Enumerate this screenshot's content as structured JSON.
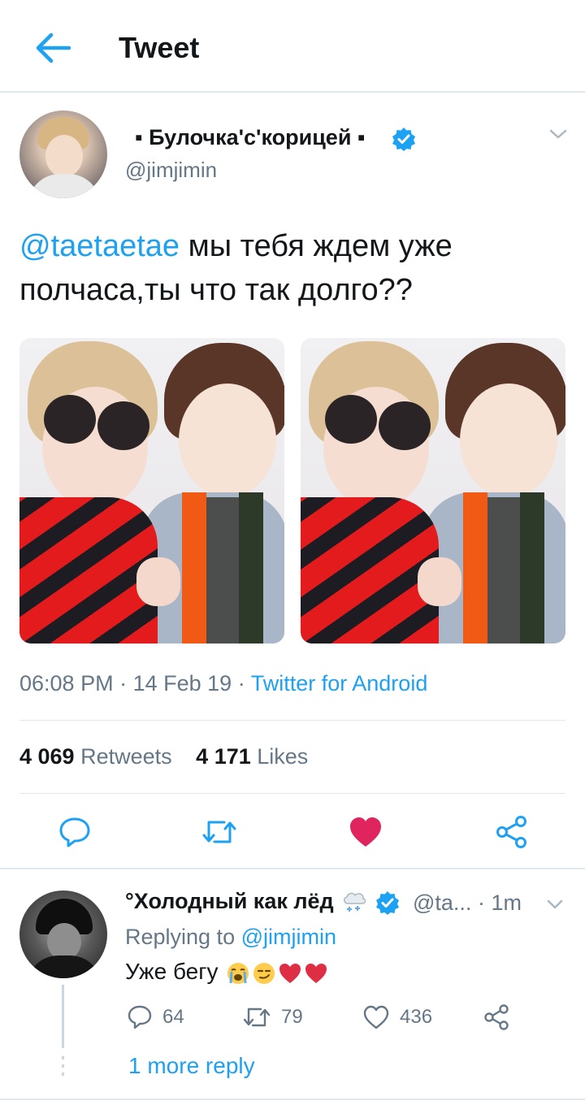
{
  "header": {
    "title": "Tweet",
    "back_icon": "arrow-left-icon"
  },
  "tweet": {
    "author_name": "▪ Булочка'с'корицей ▪",
    "handle": "@jimjimin",
    "verified": true,
    "text_mention": "@taetaetae",
    "text_body": " мы тебя ждем уже полчаса,ты что так долго??",
    "time": "06:08 PM",
    "date": "14 Feb 19",
    "separator": "·",
    "source": "Twitter for Android",
    "retweets_count": "4 069",
    "retweets_label": "Retweets",
    "likes_count": "4 171",
    "likes_label": "Likes",
    "liked": true,
    "photos": [
      "photo-1",
      "photo-2"
    ]
  },
  "reply": {
    "author_name": "°Холодный как лёд",
    "handle": "@ta...",
    "time": "· 1m",
    "replying_prefix": "Replying to",
    "replying_to": "@jimjimin",
    "text": "Уже бегу",
    "emojis": [
      "crying-face-emoji",
      "smirk-face-emoji",
      "red-heart-emoji",
      "red-heart-emoji"
    ],
    "reply_count": "64",
    "retweet_count": "79",
    "like_count": "436",
    "more_replies": "1 more reply"
  },
  "colors": {
    "accent": "#1da1f2",
    "like_active": "#e0245e",
    "secondary_text": "#657786",
    "divider": "#e1e8ed"
  }
}
